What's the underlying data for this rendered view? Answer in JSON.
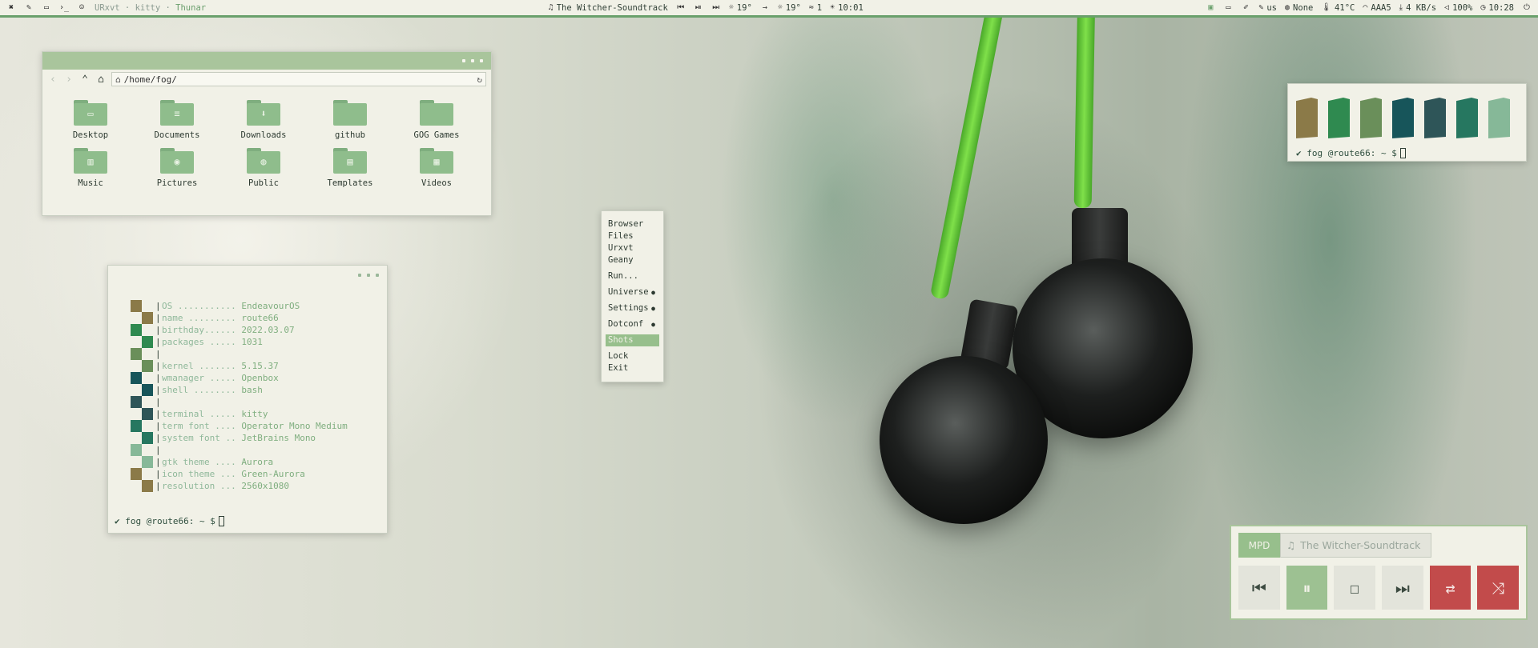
{
  "topbar": {
    "window_titles_prefix": "URxvt · kitty · ",
    "active_window": "Thunar",
    "now_playing": "The Witcher-Soundtrack",
    "weather_1": "19°",
    "weather_2": "19°",
    "wind": "1",
    "sun_time": "10:01",
    "keyboard": "us",
    "updates": "None",
    "temperature": "41°C",
    "network": "AAA5",
    "net_speed": "4 KB/s",
    "volume": "100%",
    "clock": "10:28"
  },
  "filemanager": {
    "path": "/home/fog/",
    "items": [
      {
        "label": "Desktop",
        "icon": "desktop-icon"
      },
      {
        "label": "Documents",
        "icon": "document-icon"
      },
      {
        "label": "Downloads",
        "icon": "download-icon"
      },
      {
        "label": "github",
        "icon": "folder-icon"
      },
      {
        "label": "GOG Games",
        "icon": "folder-icon"
      },
      {
        "label": "Music",
        "icon": "music-icon"
      },
      {
        "label": "Pictures",
        "icon": "camera-icon"
      },
      {
        "label": "Public",
        "icon": "globe-icon"
      },
      {
        "label": "Templates",
        "icon": "template-icon"
      },
      {
        "label": "Videos",
        "icon": "video-icon"
      }
    ]
  },
  "fetch": {
    "lines": [
      {
        "key": "OS ...........",
        "value": "EndeavourOS"
      },
      {
        "key": "name .........",
        "value": "route66"
      },
      {
        "key": "birthday......",
        "value": "2022.03.07"
      },
      {
        "key": "packages .....",
        "value": "1031"
      },
      {
        "key": "",
        "value": ""
      },
      {
        "key": "kernel .......",
        "value": "5.15.37"
      },
      {
        "key": "wmanager .....",
        "value": "Openbox"
      },
      {
        "key": "shell ........",
        "value": "bash"
      },
      {
        "key": "",
        "value": ""
      },
      {
        "key": "terminal .....",
        "value": "kitty"
      },
      {
        "key": "term font ....",
        "value": "Operator Mono Medium"
      },
      {
        "key": "system font ..",
        "value": "JetBrains Mono"
      },
      {
        "key": "",
        "value": ""
      },
      {
        "key": "gtk theme ....",
        "value": "Aurora"
      },
      {
        "key": "icon theme ...",
        "value": "Green-Aurora"
      },
      {
        "key": "resolution ...",
        "value": "2560x1080"
      }
    ],
    "prompt": "✔ fog @route66: ~ $"
  },
  "menu": {
    "items": [
      "Browser",
      "Files",
      "Urxvt",
      "Geany",
      "Run...",
      "Universe",
      "Settings",
      "Dotconf",
      "Shots",
      "Lock",
      "Exit"
    ]
  },
  "palette": {
    "colors": [
      "#8b7a48",
      "#2f8a50",
      "#6a8f5a",
      "#17555a",
      "#2e5558",
      "#267760",
      "#86b898"
    ],
    "prompt": "✔ fog @route66: ~ $"
  },
  "mpd": {
    "tag": "MPD",
    "song": "The Witcher-Soundtrack"
  },
  "colors": {
    "accent": "#6aa06c",
    "panel_bg": "#f1f1e7",
    "red": "#c24b4b"
  }
}
